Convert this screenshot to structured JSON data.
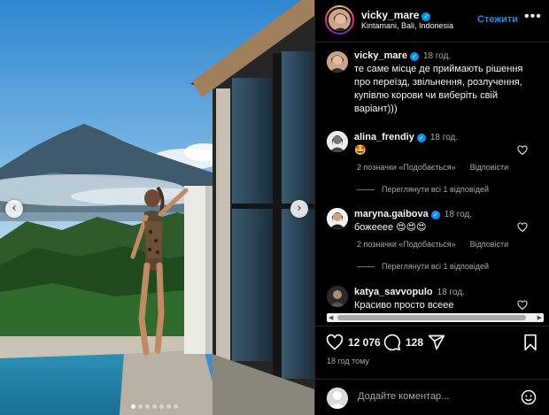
{
  "post": {
    "author": "vicky_mare",
    "location": "Kintamani, Bali, Indonesia",
    "follow_label": "Стежити",
    "more_label": "•••",
    "caption": "те саме місце де приймають рішення про переїзд, звільнення, розлучення, купівлю корови чи виберіть свій варіант)))",
    "caption_time": "18 год.",
    "likes": "12 076",
    "comments_count": "128",
    "posted_ago": "18 год тому",
    "carousel": {
      "slides": 7,
      "active": 1
    }
  },
  "comments": [
    {
      "user": "alina_frendiy",
      "verified": true,
      "time": "18 год.",
      "text": "🤩",
      "likes_label": "2 позначки «Подобається»",
      "reply_label": "Відповісти",
      "view_replies": "Переглянути всі 1 відповідей"
    },
    {
      "user": "maryna.gaibova",
      "verified": true,
      "time": "18 год.",
      "text": "божееее 😍😍😍",
      "likes_label": "2 позначки «Подобається»",
      "reply_label": "Відповісти",
      "view_replies": "Переглянути всі 1 відповідей"
    },
    {
      "user": "katya_savvopulo",
      "verified": false,
      "time": "18 год.",
      "text": "Красиво просто всеее"
    }
  ],
  "add_comment": {
    "placeholder": "Додайте коментар..."
  },
  "icons": {
    "verified": "verified-badge-icon",
    "like": "heart-icon",
    "comment": "comment-bubble-icon",
    "share": "paper-plane-icon",
    "save": "bookmark-icon",
    "emoji": "emoji-smile-icon",
    "prev": "chevron-left-icon",
    "next": "chevron-right-icon"
  },
  "colors": {
    "accent": "#0095f6",
    "background": "#000000",
    "muted": "#a8a8a8"
  }
}
